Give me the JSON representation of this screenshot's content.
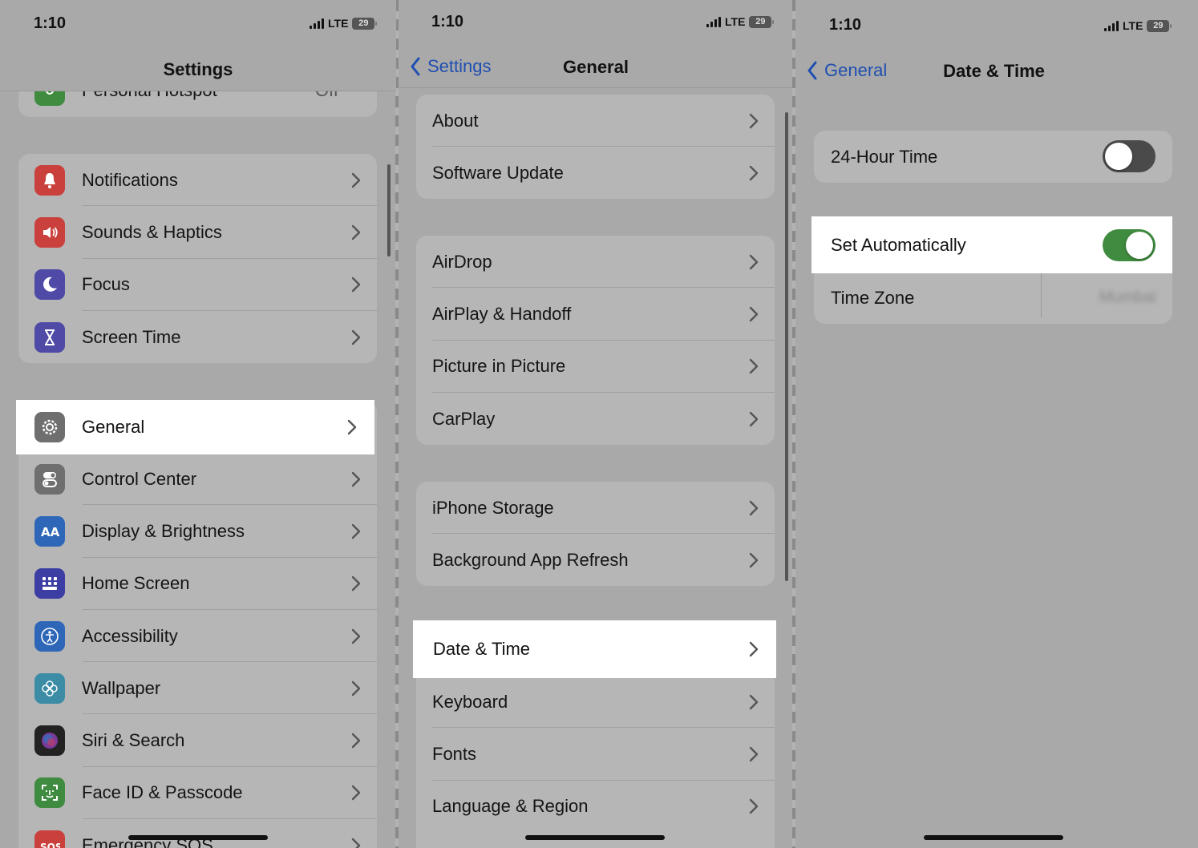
{
  "colors": {
    "back_blue": "#1f4fb0",
    "toggle_on": "#3f8b3f",
    "toggle_off": "#4a4a4a"
  },
  "status_bar": {
    "time": "1:10",
    "network": "LTE",
    "battery": "29"
  },
  "settings_panel": {
    "title": "Settings",
    "partial_row": {
      "label": "Personal Hotspot",
      "value": "Off",
      "icon": "hotspot-icon"
    },
    "group1": [
      {
        "label": "Notifications",
        "icon": "bell-icon",
        "color": "#c9403c"
      },
      {
        "label": "Sounds & Haptics",
        "icon": "speaker-icon",
        "color": "#c9403c"
      },
      {
        "label": "Focus",
        "icon": "moon-icon",
        "color": "#4e4aa6"
      },
      {
        "label": "Screen Time",
        "icon": "hourglass-icon",
        "color": "#4e4aa6"
      }
    ],
    "highlighted": {
      "label": "General",
      "icon": "gear-icon",
      "color": "#6f6f6f"
    },
    "group2": [
      {
        "label": "Control Center",
        "icon": "switches-icon",
        "color": "#6f6f6f"
      },
      {
        "label": "Display & Brightness",
        "icon": "text-size-icon",
        "color": "#2f67b8"
      },
      {
        "label": "Home Screen",
        "icon": "app-grid-icon",
        "color": "#3d3ea3"
      },
      {
        "label": "Accessibility",
        "icon": "accessibility-icon",
        "color": "#2f67b8"
      },
      {
        "label": "Wallpaper",
        "icon": "flower-icon",
        "color": "#3c8ca6"
      },
      {
        "label": "Siri & Search",
        "icon": "siri-icon",
        "color": "#222222"
      },
      {
        "label": "Face ID & Passcode",
        "icon": "face-id-icon",
        "color": "#3f8b3f"
      },
      {
        "label": "Emergency SOS",
        "icon": "sos-icon",
        "color": "#c9403c"
      }
    ]
  },
  "general_panel": {
    "back_label": "Settings",
    "title": "General",
    "group1": [
      "About",
      "Software Update"
    ],
    "group2": [
      "AirDrop",
      "AirPlay & Handoff",
      "Picture in Picture",
      "CarPlay"
    ],
    "group3": [
      "iPhone Storage",
      "Background App Refresh"
    ],
    "highlighted": "Date & Time",
    "group4": [
      "Keyboard",
      "Fonts",
      "Language & Region"
    ]
  },
  "datetime_panel": {
    "back_label": "General",
    "title": "Date & Time",
    "hour24": {
      "label": "24-Hour Time",
      "on": false
    },
    "set_auto": {
      "label": "Set Automatically",
      "on": true
    },
    "timezone": {
      "label": "Time Zone",
      "value": "Mumbai"
    }
  }
}
